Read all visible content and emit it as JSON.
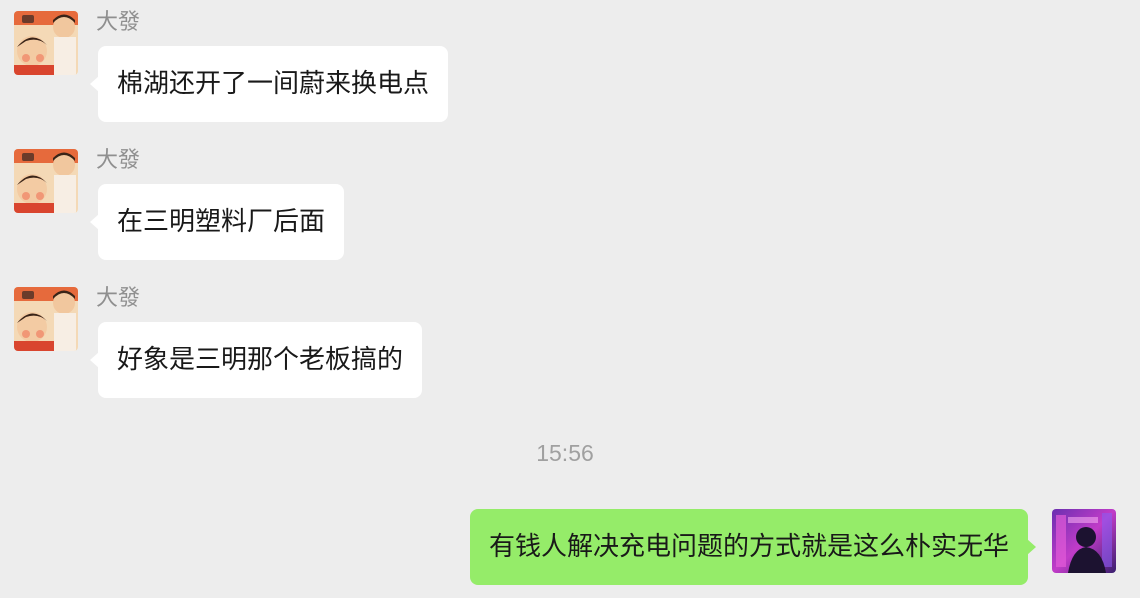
{
  "messages": [
    {
      "sender": "大發",
      "text": "棉湖还开了一间蔚来换电点"
    },
    {
      "sender": "大發",
      "text": "在三明塑料厂后面"
    },
    {
      "sender": "大發",
      "text": "好象是三明那个老板搞的"
    }
  ],
  "time_divider": "15:56",
  "outgoing": {
    "text": "有钱人解决充电问题的方式就是这么朴实无华"
  },
  "colors": {
    "background": "#ededed",
    "incoming_bubble": "#ffffff",
    "outgoing_bubble": "#95ec69",
    "sender_name": "#8f8f8f",
    "timestamp": "#a0a0a0"
  }
}
